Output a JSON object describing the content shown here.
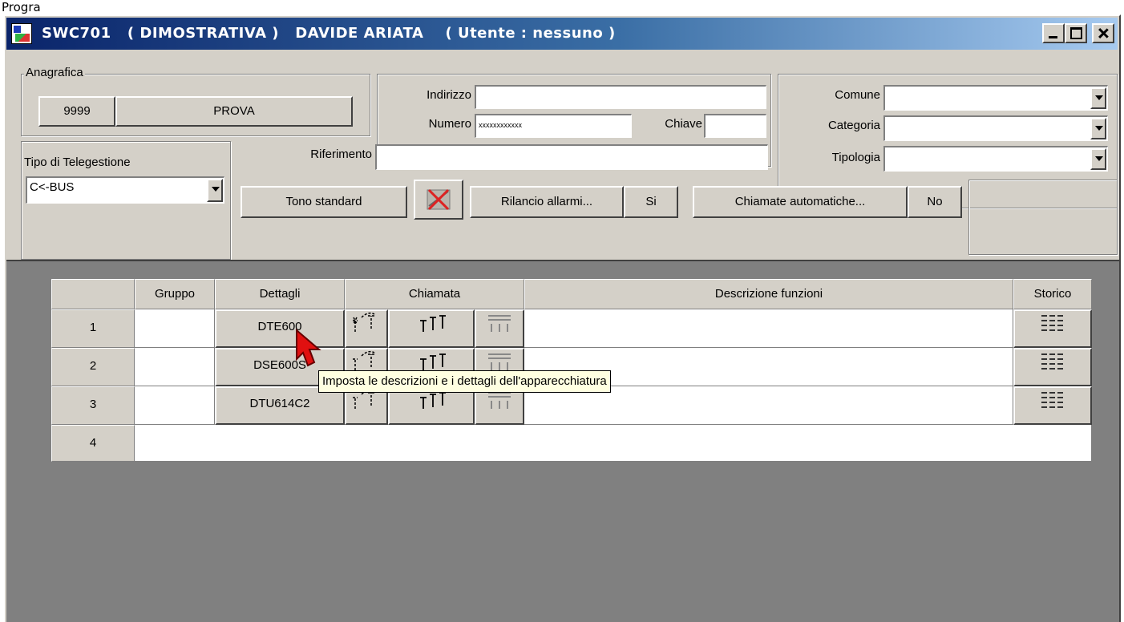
{
  "header_partial": "Progra",
  "window": {
    "title": "SWC701   ( DIMOSTRATIVA )   DAVIDE ARIATA    ( Utente : nessuno )"
  },
  "anagrafica": {
    "group_label": "Anagrafica",
    "code": "9999",
    "name": "PROVA",
    "indirizzo_label": "Indirizzo",
    "indirizzo_value": "",
    "numero_label": "Numero",
    "numero_value": "xxxxxxxxxxxx",
    "chiave_label": "Chiave",
    "chiave_value": "",
    "comune_label": "Comune",
    "comune_value": "",
    "categoria_label": "Categoria",
    "categoria_value": "",
    "tipologia_label": "Tipologia",
    "tipologia_value": "",
    "riferimento_label": "Riferimento",
    "riferimento_value": ""
  },
  "telegestione": {
    "label": "Tipo di Telegestione",
    "value": "C<-BUS"
  },
  "toolbar": {
    "tono_label": "Tono standard",
    "rilancio_label": "Rilancio allarmi...",
    "rilancio_value": "Si",
    "chiamate_label": "Chiamate automatiche...",
    "chiamate_value": "No"
  },
  "table": {
    "headers": [
      "",
      "Gruppo",
      "Dettagli",
      "Chiamata",
      "Descrizione funzioni",
      "Storico"
    ],
    "rows": [
      {
        "num": "1",
        "gruppo": "",
        "dettagli": "DTE600",
        "descrizione": ""
      },
      {
        "num": "2",
        "gruppo": "",
        "dettagli": "DSE600S",
        "descrizione": ""
      },
      {
        "num": "3",
        "gruppo": "",
        "dettagli": "DTU614C2",
        "descrizione": ""
      },
      {
        "num": "4",
        "gruppo": "",
        "dettagli": "",
        "descrizione": ""
      }
    ]
  },
  "tooltip": "Imposta le descrizioni e i dettagli dell'apparecchiatura"
}
